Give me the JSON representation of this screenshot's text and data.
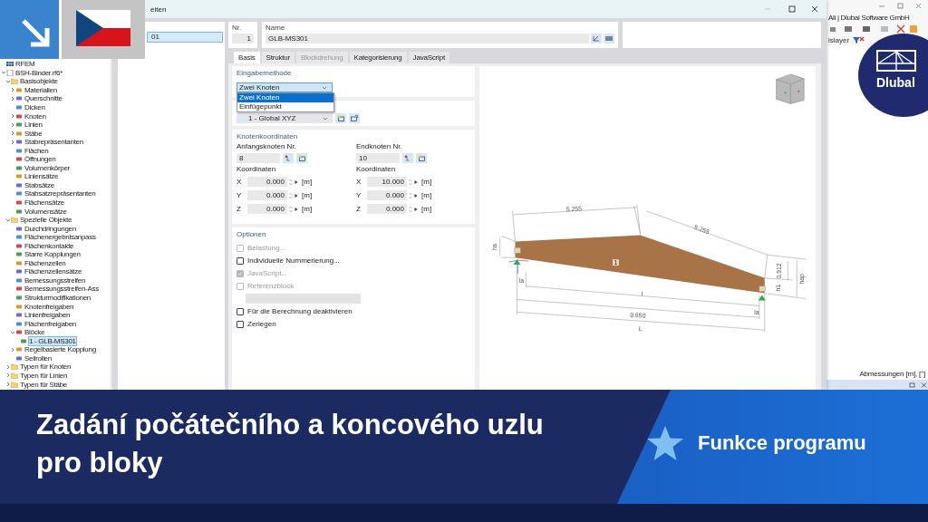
{
  "navigator": {
    "tree": [
      {
        "label": "RFEM",
        "kind": "root",
        "selected": false
      },
      {
        "label": "BSH-Binder.rf6*",
        "kind": "file",
        "expanded": true,
        "selected": false,
        "children": [
          {
            "label": "Basisobjekte",
            "kind": "folder",
            "expanded": true,
            "selected": false,
            "children": [
              {
                "label": "Materialien",
                "kind": "object",
                "expanded": false,
                "selected": false
              },
              {
                "label": "Querschnitte",
                "kind": "object",
                "expanded": false,
                "selected": false
              },
              {
                "label": "Dicken",
                "kind": "object",
                "selected": false
              },
              {
                "label": "Knoten",
                "kind": "object",
                "expanded": false,
                "selected": false
              },
              {
                "label": "Linien",
                "kind": "object",
                "expanded": false,
                "selected": false
              },
              {
                "label": "Stäbe",
                "kind": "object",
                "expanded": false,
                "selected": false
              },
              {
                "label": "Stabrepräsentanten",
                "kind": "object",
                "expanded": false,
                "selected": false
              },
              {
                "label": "Flächen",
                "kind": "object",
                "selected": false
              },
              {
                "label": "Öffnungen",
                "kind": "object",
                "selected": false
              },
              {
                "label": "Volumenkörper",
                "kind": "object",
                "selected": false
              },
              {
                "label": "Liniensätze",
                "kind": "object",
                "selected": false
              },
              {
                "label": "Stabsätze",
                "kind": "object",
                "selected": false
              },
              {
                "label": "Stabsatzrepräsentanten",
                "kind": "object",
                "selected": false
              },
              {
                "label": "Flächensätze",
                "kind": "object",
                "selected": false
              },
              {
                "label": "Volumensätze",
                "kind": "object",
                "selected": false
              }
            ]
          },
          {
            "label": "Spezielle Objekte",
            "kind": "folder",
            "expanded": true,
            "selected": false,
            "children": [
              {
                "label": "Durchdringungen",
                "kind": "object",
                "selected": false
              },
              {
                "label": "Flächenergebnisanpass",
                "kind": "object",
                "selected": false
              },
              {
                "label": "Flächenkontakte",
                "kind": "object",
                "selected": false
              },
              {
                "label": "Starre Kopplungen",
                "kind": "object",
                "selected": false
              },
              {
                "label": "Flächenzellen",
                "kind": "object",
                "selected": false
              },
              {
                "label": "Flächenzellensätze",
                "kind": "object",
                "selected": false
              },
              {
                "label": "Bemessungsstreifen",
                "kind": "object",
                "selected": false
              },
              {
                "label": "Bemessungsstreifen-Ass",
                "kind": "object",
                "selected": false
              },
              {
                "label": "Strukturmodifikationen",
                "kind": "object",
                "selected": false
              },
              {
                "label": "Knotenfreigaben",
                "kind": "object",
                "selected": false
              },
              {
                "label": "Linienfreigaben",
                "kind": "object",
                "selected": false
              },
              {
                "label": "Flächenfreigaben",
                "kind": "object",
                "selected": false
              },
              {
                "label": "Blöcke",
                "kind": "object",
                "expanded": true,
                "selected": false,
                "children": [
                  {
                    "label": "1 - GLB-MS301",
                    "kind": "object",
                    "selected": true
                  }
                ]
              },
              {
                "label": "Regelbasierte Kopplung",
                "kind": "object",
                "expanded": false,
                "selected": false
              },
              {
                "label": "Seilrollen",
                "kind": "object",
                "selected": false
              }
            ]
          },
          {
            "label": "Typen für Knoten",
            "kind": "folder",
            "expanded": false,
            "selected": false
          },
          {
            "label": "Typen für Linien",
            "kind": "folder",
            "expanded": false,
            "selected": false
          },
          {
            "label": "Typen für Stäbe",
            "kind": "folder",
            "expanded": false,
            "selected": false
          }
        ]
      }
    ]
  },
  "main_window": {
    "title": "Ali | Dlubal Software GmbH",
    "layer_dropdown": "islayer",
    "status_text": "Abmessungen [m], [°]"
  },
  "dialog": {
    "title": "eiten",
    "list": [
      {
        "label": "01",
        "selected": true
      }
    ],
    "nr": {
      "label": "Nr.",
      "value": "1"
    },
    "name": {
      "label": "Name",
      "value": "GLB-MS301"
    },
    "tabs": [
      {
        "label": "Basis",
        "selected": true,
        "disabled": false
      },
      {
        "label": "Struktur",
        "selected": false,
        "disabled": false
      },
      {
        "label": "Blockdrehung",
        "selected": false,
        "disabled": true
      },
      {
        "label": "Kategorisierung",
        "selected": false,
        "disabled": false
      },
      {
        "label": "JavaScript",
        "selected": false,
        "disabled": false
      }
    ],
    "input_method": {
      "title": "Eingabemethode",
      "value": "Zwei Knoten",
      "expanded": true,
      "options": [
        {
          "label": "Zwei Knoten",
          "selected": true
        },
        {
          "label": "Einfügepunkt",
          "selected": false
        }
      ]
    },
    "coordinate_system": {
      "value": "1 - Global XYZ"
    },
    "node_coordinates": {
      "title": "Knotenkoordinaten",
      "nodes": [
        {
          "label": "Anfangsknoten Nr.",
          "value": "8",
          "coords_label": "Koordinaten",
          "coords": [
            {
              "axis": "X",
              "value": "0.000",
              "unit": "[m]"
            },
            {
              "axis": "Y",
              "value": "0.000",
              "unit": "[m]"
            },
            {
              "axis": "Z",
              "value": "0.000",
              "unit": "[m]"
            }
          ]
        },
        {
          "label": "Endknoten Nr.",
          "value": "10",
          "coords_label": "Koordinaten",
          "coords": [
            {
              "axis": "X",
              "value": "10.000",
              "unit": "[m]"
            },
            {
              "axis": "Y",
              "value": "0.000",
              "unit": "[m]"
            },
            {
              "axis": "Z",
              "value": "0.000",
              "unit": "[m]"
            }
          ]
        }
      ]
    },
    "options": {
      "title": "Optionen",
      "items": [
        {
          "kind": "checkbox",
          "label": "Belastung...",
          "checked": false,
          "disabled": true
        },
        {
          "kind": "checkbox",
          "label": "Individuelle Nummerierung...",
          "checked": false,
          "disabled": false
        },
        {
          "kind": "checkbox",
          "label": "JavaScript...",
          "checked": true,
          "disabled": true
        },
        {
          "kind": "checkbox",
          "label": "Referenzblock",
          "checked": false,
          "disabled": true
        },
        {
          "kind": "field",
          "disabled": true
        },
        {
          "kind": "checkbox",
          "label": "Für die Berechnung deaktivieren",
          "checked": false,
          "disabled": false
        },
        {
          "kind": "checkbox",
          "label": "Zerlegen",
          "checked": false,
          "disabled": false
        }
      ]
    },
    "preview": {
      "member_label": "1",
      "dimension_labels": [
        "5.255",
        "5.255",
        "l",
        "9.650",
        "L",
        "0.912",
        "hap",
        "hs",
        "h1",
        "la",
        "la"
      ]
    }
  },
  "logo": {
    "text": "Dlubal"
  },
  "banner": {
    "title_lines": [
      "Zadání počátečního a koncového uzlu",
      "pro bloky"
    ],
    "category": "Funkce programu"
  }
}
